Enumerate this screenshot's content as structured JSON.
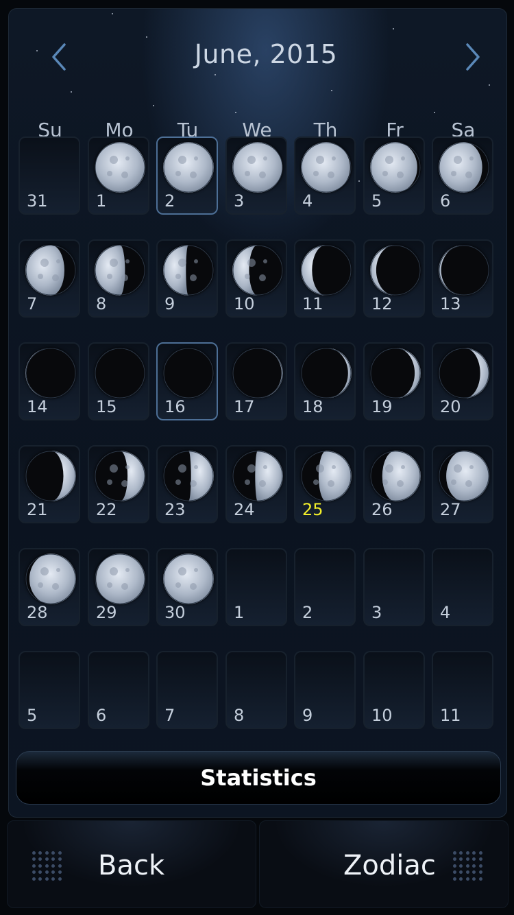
{
  "header": {
    "title": "June, 2015",
    "prev_icon": "chevron-left-icon",
    "next_icon": "chevron-right-icon",
    "accent": "#5a88b8"
  },
  "weekdays": [
    "Su",
    "Mo",
    "Tu",
    "We",
    "Th",
    "Fr",
    "Sa"
  ],
  "calendar": {
    "today_color": "#f2ef2a",
    "cells": [
      {
        "day": "31",
        "illum": null,
        "waxing": null,
        "selected": false,
        "today": false
      },
      {
        "day": "1",
        "illum": 0.99,
        "waxing": true,
        "selected": false,
        "today": false
      },
      {
        "day": "2",
        "illum": 1.0,
        "waxing": true,
        "selected": true,
        "today": false
      },
      {
        "day": "3",
        "illum": 0.99,
        "waxing": false,
        "selected": false,
        "today": false
      },
      {
        "day": "4",
        "illum": 0.97,
        "waxing": false,
        "selected": false,
        "today": false
      },
      {
        "day": "5",
        "illum": 0.93,
        "waxing": false,
        "selected": false,
        "today": false
      },
      {
        "day": "6",
        "illum": 0.86,
        "waxing": false,
        "selected": false,
        "today": false
      },
      {
        "day": "7",
        "illum": 0.77,
        "waxing": false,
        "selected": false,
        "today": false
      },
      {
        "day": "8",
        "illum": 0.6,
        "waxing": false,
        "selected": false,
        "today": false
      },
      {
        "day": "9",
        "illum": 0.45,
        "waxing": false,
        "selected": false,
        "today": false
      },
      {
        "day": "10",
        "illum": 0.33,
        "waxing": false,
        "selected": false,
        "today": false
      },
      {
        "day": "11",
        "illum": 0.22,
        "waxing": false,
        "selected": false,
        "today": false
      },
      {
        "day": "12",
        "illum": 0.12,
        "waxing": false,
        "selected": false,
        "today": false
      },
      {
        "day": "13",
        "illum": 0.05,
        "waxing": false,
        "selected": false,
        "today": false
      },
      {
        "day": "14",
        "illum": 0.02,
        "waxing": false,
        "selected": false,
        "today": false
      },
      {
        "day": "15",
        "illum": 0.0,
        "waxing": true,
        "selected": false,
        "today": false
      },
      {
        "day": "16",
        "illum": 0.0,
        "waxing": true,
        "selected": true,
        "today": false
      },
      {
        "day": "17",
        "illum": 0.03,
        "waxing": true,
        "selected": false,
        "today": false
      },
      {
        "day": "18",
        "illum": 0.07,
        "waxing": true,
        "selected": false,
        "today": false
      },
      {
        "day": "19",
        "illum": 0.12,
        "waxing": true,
        "selected": false,
        "today": false
      },
      {
        "day": "20",
        "illum": 0.18,
        "waxing": true,
        "selected": false,
        "today": false
      },
      {
        "day": "21",
        "illum": 0.25,
        "waxing": true,
        "selected": false,
        "today": false
      },
      {
        "day": "22",
        "illum": 0.35,
        "waxing": true,
        "selected": false,
        "today": false
      },
      {
        "day": "23",
        "illum": 0.45,
        "waxing": true,
        "selected": false,
        "today": false
      },
      {
        "day": "24",
        "illum": 0.55,
        "waxing": true,
        "selected": false,
        "today": false
      },
      {
        "day": "25",
        "illum": 0.65,
        "waxing": true,
        "selected": false,
        "today": true
      },
      {
        "day": "26",
        "illum": 0.76,
        "waxing": true,
        "selected": false,
        "today": false
      },
      {
        "day": "27",
        "illum": 0.85,
        "waxing": true,
        "selected": false,
        "today": false
      },
      {
        "day": "28",
        "illum": 0.92,
        "waxing": true,
        "selected": false,
        "today": false
      },
      {
        "day": "29",
        "illum": 0.97,
        "waxing": true,
        "selected": false,
        "today": false
      },
      {
        "day": "30",
        "illum": 1.0,
        "waxing": true,
        "selected": false,
        "today": false
      },
      {
        "day": "1",
        "illum": null,
        "waxing": null,
        "selected": false,
        "today": false
      },
      {
        "day": "2",
        "illum": null,
        "waxing": null,
        "selected": false,
        "today": false
      },
      {
        "day": "3",
        "illum": null,
        "waxing": null,
        "selected": false,
        "today": false
      },
      {
        "day": "4",
        "illum": null,
        "waxing": null,
        "selected": false,
        "today": false
      },
      {
        "day": "5",
        "illum": null,
        "waxing": null,
        "selected": false,
        "today": false
      },
      {
        "day": "6",
        "illum": null,
        "waxing": null,
        "selected": false,
        "today": false
      },
      {
        "day": "7",
        "illum": null,
        "waxing": null,
        "selected": false,
        "today": false
      },
      {
        "day": "8",
        "illum": null,
        "waxing": null,
        "selected": false,
        "today": false
      },
      {
        "day": "9",
        "illum": null,
        "waxing": null,
        "selected": false,
        "today": false
      },
      {
        "day": "10",
        "illum": null,
        "waxing": null,
        "selected": false,
        "today": false
      },
      {
        "day": "11",
        "illum": null,
        "waxing": null,
        "selected": false,
        "today": false
      }
    ]
  },
  "statistics_button": {
    "label": "Statistics"
  },
  "footer": {
    "back": {
      "label": "Back",
      "icon": "grid-dots-icon"
    },
    "zodiac": {
      "label": "Zodiac",
      "icon": "grid-dots-icon"
    }
  }
}
